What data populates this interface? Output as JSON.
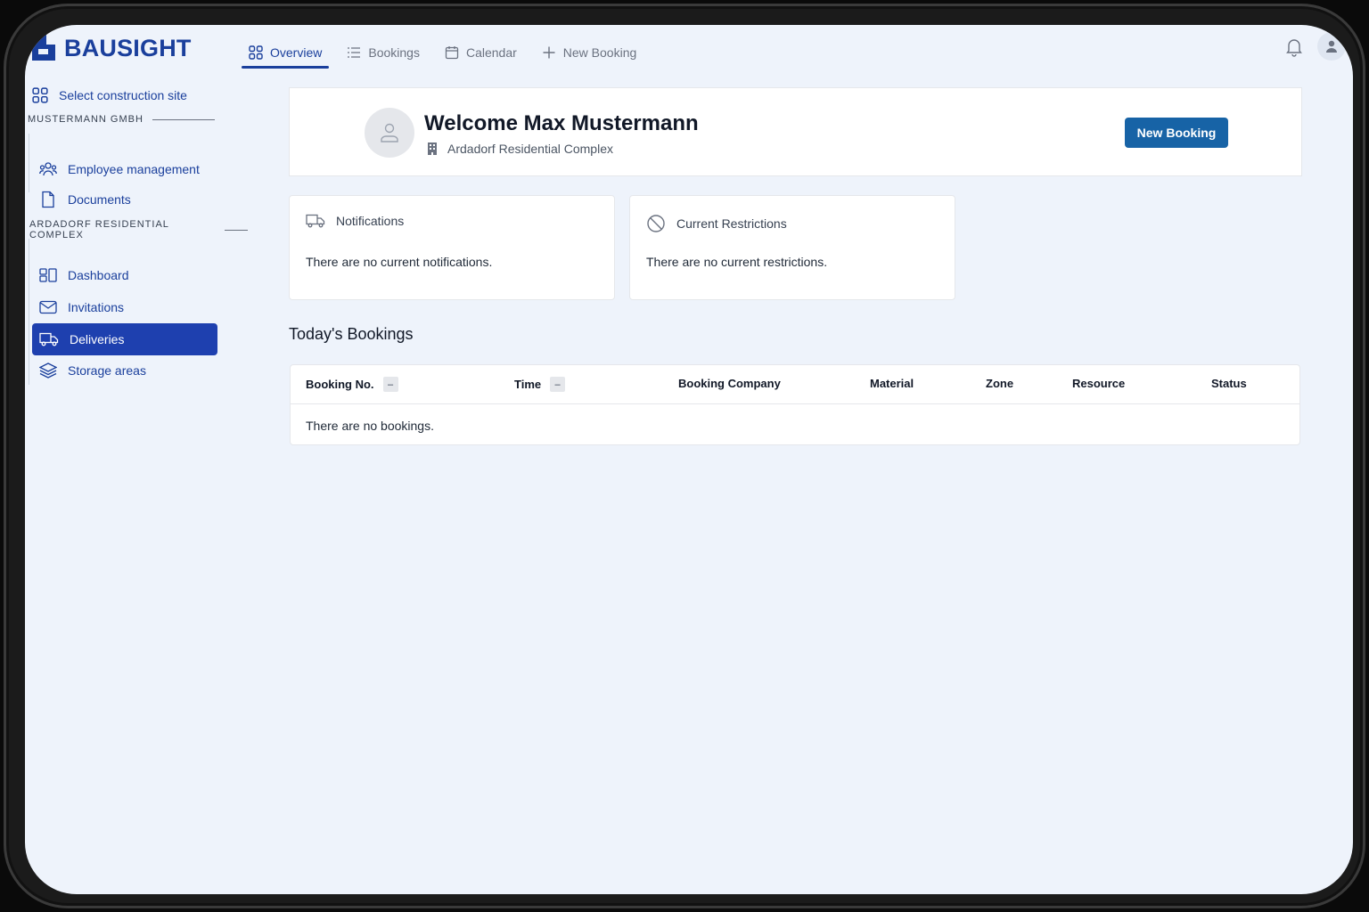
{
  "brand": {
    "name": "BAUSIGHT",
    "color": "#1a3f9c"
  },
  "topnav": {
    "tabs": [
      {
        "label": "Overview",
        "icon": "grid-icon",
        "active": true
      },
      {
        "label": "Bookings",
        "icon": "list-icon"
      },
      {
        "label": "Calendar",
        "icon": "calendar-icon"
      },
      {
        "label": "New Booking",
        "icon": "plus-icon"
      }
    ],
    "notifications_icon": "bell-icon",
    "avatar_icon": "user-icon"
  },
  "sidebar": {
    "select_site": "Select construction site",
    "company": {
      "title": "MUSTERMANN GMBH",
      "items": [
        {
          "label": "Employee management",
          "icon": "users-icon"
        },
        {
          "label": "Documents",
          "icon": "document-icon"
        }
      ]
    },
    "site": {
      "title": "ARDADORF RESIDENTIAL COMPLEX",
      "items": [
        {
          "label": "Dashboard",
          "icon": "dashboard-icon"
        },
        {
          "label": "Invitations",
          "icon": "mail-icon"
        },
        {
          "label": "Deliveries",
          "icon": "truck-icon",
          "active": true
        },
        {
          "label": "Storage areas",
          "icon": "layers-icon"
        }
      ]
    }
  },
  "welcome": {
    "title": "Welcome Max Mustermann",
    "site": "Ardadorf Residential Complex",
    "new_booking": "New Booking"
  },
  "cards": {
    "notifications": {
      "title": "Notifications",
      "body": "There are no current notifications."
    },
    "restrictions": {
      "title": "Current Restrictions",
      "body": "There are no current restrictions."
    }
  },
  "bookings": {
    "title": "Today's Bookings",
    "columns": [
      "Booking No.",
      "Time",
      "Booking Company",
      "Material",
      "Zone",
      "Resource",
      "Status"
    ],
    "sort_symbol": "–",
    "empty": "There are no bookings."
  },
  "colors": {
    "accent": "#1e40af",
    "button": "#1763a6",
    "background": "#eef3fb"
  }
}
